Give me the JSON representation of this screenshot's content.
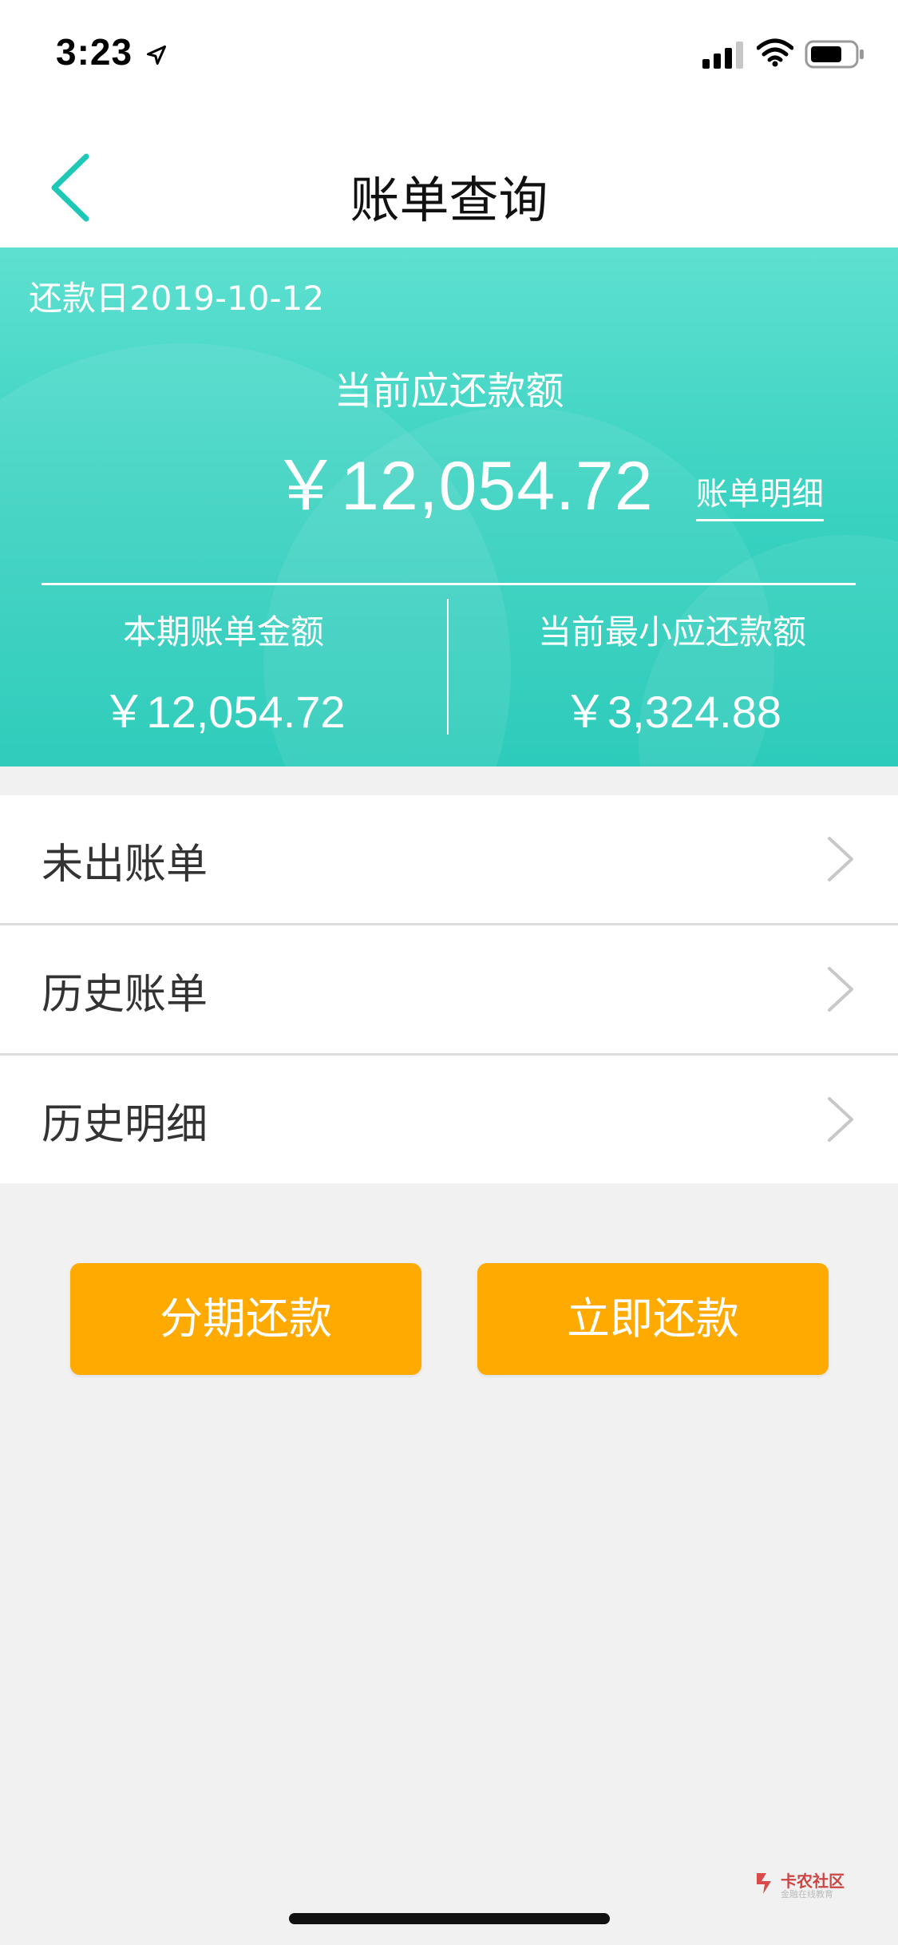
{
  "status_bar": {
    "time": "3:23",
    "icons": [
      "location-arrow-icon",
      "signal-icon",
      "wifi-icon",
      "battery-icon"
    ]
  },
  "nav": {
    "title": "账单查询",
    "back_icon": "chevron-left-icon",
    "accent_color": "#1ec8b6"
  },
  "summary": {
    "due_date": "还款日2019-10-12",
    "current_label": "当前应还款额",
    "current_amount": "￥12,054.72",
    "detail_link": "账单明细",
    "statement_label": "本期账单金额",
    "statement_amount": "￥12,054.72",
    "min_label": "当前最小应还款额",
    "min_amount": "￥3,324.88",
    "gradient_top": "#5ee0d0",
    "gradient_bottom": "#1ec8b6"
  },
  "list": {
    "items": [
      {
        "label": "未出账单",
        "icon": "chevron-right-icon"
      },
      {
        "label": "历史账单",
        "icon": "chevron-right-icon"
      },
      {
        "label": "历史明细",
        "icon": "chevron-right-icon"
      }
    ]
  },
  "actions": {
    "installment_label": "分期还款",
    "pay_now_label": "立即还款",
    "button_color": "#ffaa00"
  },
  "watermark": {
    "title": "卡农社区",
    "subtitle": "金融在线教育"
  }
}
